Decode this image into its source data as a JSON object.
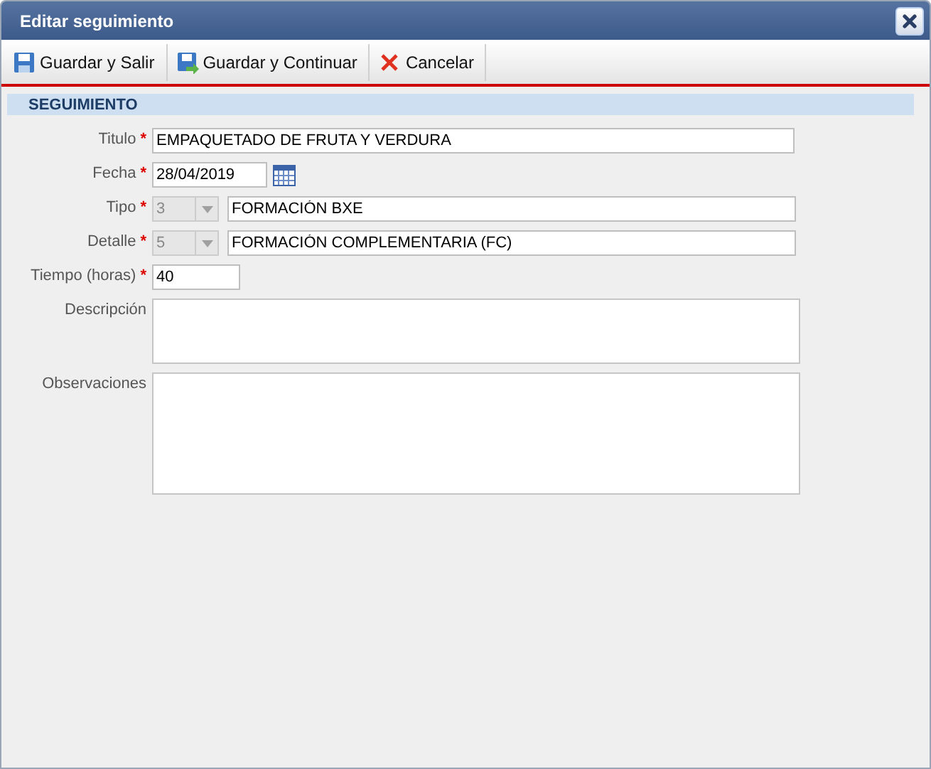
{
  "window": {
    "title": "Editar seguimiento"
  },
  "toolbar": [
    {
      "kind": "save",
      "label": "Guardar y Salir"
    },
    {
      "kind": "save-continue",
      "label": "Guardar y Continuar"
    },
    {
      "kind": "cancel",
      "label": "Cancelar"
    }
  ],
  "section": {
    "title": "SEGUIMIENTO"
  },
  "fields": [
    {
      "kind": "text",
      "label": "Titulo",
      "required_mark": "*",
      "value": "EMPAQUETADO DE FRUTA Y VERDURA"
    },
    {
      "kind": "date",
      "label": "Fecha",
      "required_mark": "*",
      "value": "28/04/2019"
    },
    {
      "kind": "combo",
      "label": "Tipo",
      "required_mark": "*",
      "code": "3",
      "disabled": true,
      "value": "FORMACIÓN BXE"
    },
    {
      "kind": "combo",
      "label": "Detalle",
      "required_mark": "*",
      "code": "5",
      "disabled": true,
      "value": "FORMACIÓN COMPLEMENTARIA (FC)"
    },
    {
      "kind": "short",
      "label": "Tiempo (horas)",
      "required_mark": "*",
      "value": "40"
    },
    {
      "kind": "textarea",
      "label": "Descripción"
    },
    {
      "kind": "textarea-tall",
      "label": "Observaciones"
    }
  ]
}
